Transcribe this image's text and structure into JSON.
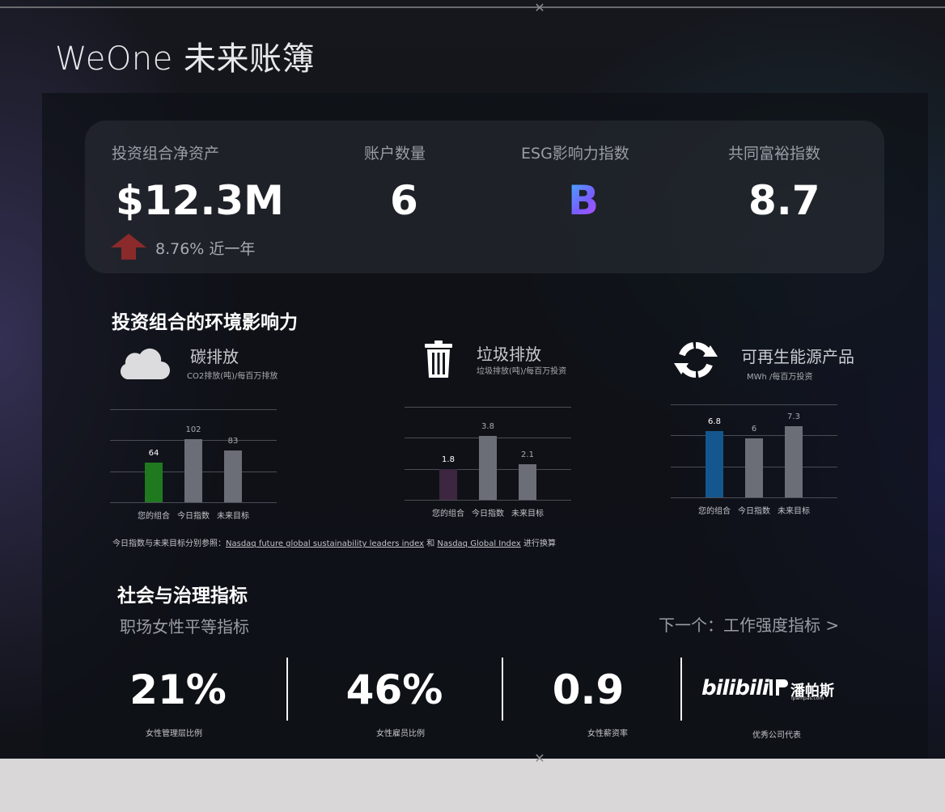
{
  "app": {
    "title": "WeOne 未来账簿"
  },
  "colors": {
    "accent_up": "#8a2a2a",
    "portfolio_carbon": "#1f7a1f",
    "portfolio_waste": "#3d2640",
    "portfolio_energy": "#13578e",
    "benchmark": "#6b6e76"
  },
  "stats": [
    {
      "label": "投资组合净资产",
      "value": "$12.3M"
    },
    {
      "label": "账户数量",
      "value": "6"
    },
    {
      "label": "ESG影响力指数",
      "value": "B"
    },
    {
      "label": "共同富裕指数",
      "value": "8.7"
    }
  ],
  "growth": {
    "icon": "arrow-up-icon",
    "text": "8.76% 近一年"
  },
  "environment": {
    "title": "投资组合的环境影响力",
    "note_prefix": "今日指数与未来目标分别参照：",
    "note_link1": "Nasdaq future global sustainability leaders index",
    "note_and": " 和 ",
    "note_link2": "Nasdaq  Global Index",
    "note_suffix": "  进行换算",
    "metrics": [
      {
        "icon": "cloud-icon",
        "name": "碳排放",
        "unit": "CO2排放(吨)/每百万排放"
      },
      {
        "icon": "trash-icon",
        "name": "垃圾排放",
        "unit": "垃圾排放(吨)/每百万投资"
      },
      {
        "icon": "recycle-icon",
        "name": "可再生能源产品",
        "unit": "MWh /每百万投资"
      }
    ]
  },
  "chart_data": [
    {
      "type": "bar",
      "title": "碳排放",
      "categories": [
        "您的组合",
        "今日指数",
        "未来目标"
      ],
      "values": [
        64,
        102,
        83
      ],
      "ylim": [
        0,
        150
      ],
      "grid": true
    },
    {
      "type": "bar",
      "title": "垃圾排放",
      "categories": [
        "您的组合",
        "今日指数",
        "未来目标"
      ],
      "values": [
        1.8,
        3.8,
        2.1
      ],
      "ylim": [
        0,
        5.5
      ],
      "grid": true
    },
    {
      "type": "bar",
      "title": "可再生能源产品",
      "categories": [
        "您的组合",
        "今日指数",
        "未来目标"
      ],
      "values": [
        6.8,
        6,
        7.3
      ],
      "ylim": [
        0,
        9.5
      ],
      "grid": true
    }
  ],
  "social": {
    "title": "社会与治理指标",
    "subtitle": "职场女性平等指标",
    "next_label": "下一个：工作强度指标  >",
    "items": [
      {
        "value": "21%",
        "label": "女性管理层比例"
      },
      {
        "value": "46%",
        "label": "女性雇员比例"
      },
      {
        "value": "0.9",
        "label": "女性薪资率"
      }
    ],
    "logos": {
      "logo1": "bilibili",
      "logo2": "潘帕斯",
      "logo2_sub": "ipampas.com",
      "label": "优秀公司代表"
    }
  }
}
